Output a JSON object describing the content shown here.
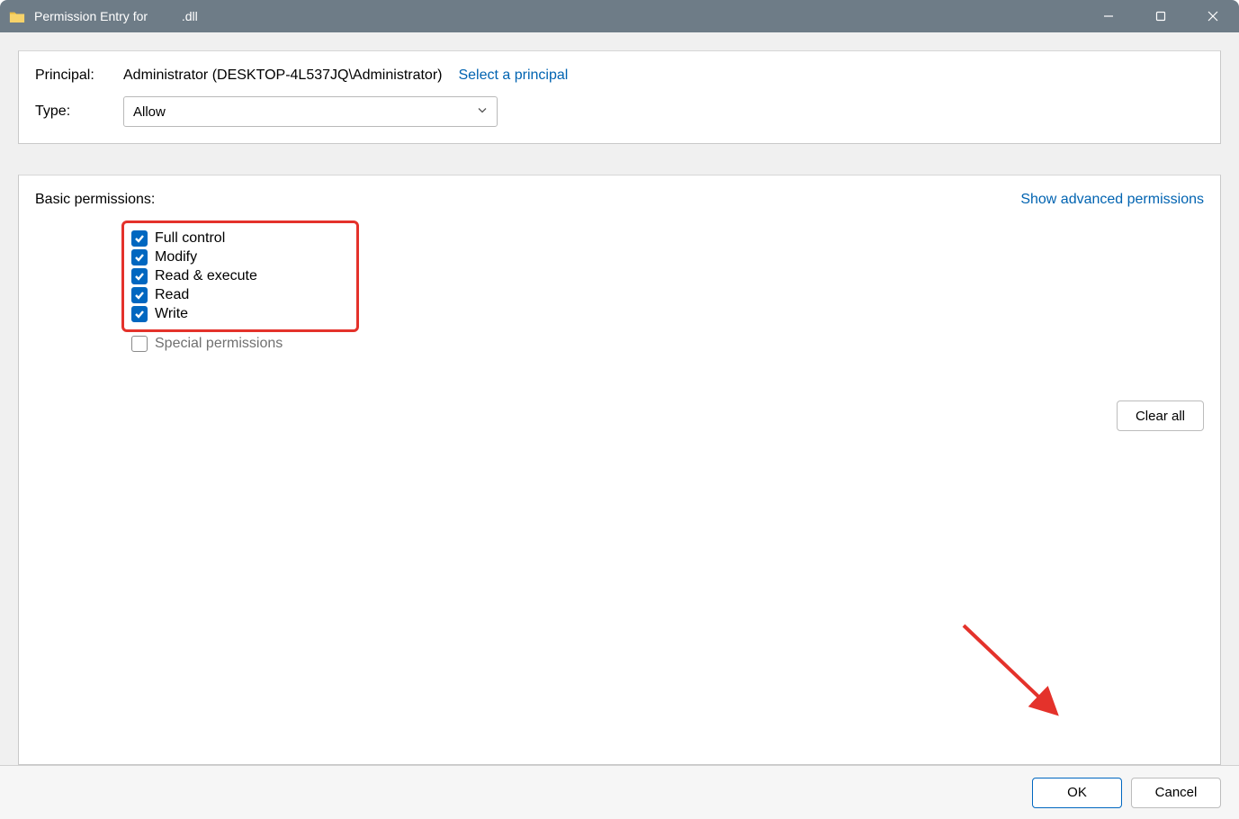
{
  "titlebar": {
    "prefix": "Permission Entry for",
    "filename_suffix": ".dll"
  },
  "top": {
    "principal_label": "Principal:",
    "principal_value": "Administrator (DESKTOP-4L537JQ\\Administrator)",
    "select_principal_link": "Select a principal",
    "type_label": "Type:",
    "type_value": "Allow"
  },
  "permissions": {
    "section_label": "Basic permissions:",
    "advanced_link": "Show advanced permissions",
    "items": {
      "full_control": {
        "label": "Full control",
        "checked": true
      },
      "modify": {
        "label": "Modify",
        "checked": true
      },
      "read_exec": {
        "label": "Read & execute",
        "checked": true
      },
      "read": {
        "label": "Read",
        "checked": true
      },
      "write": {
        "label": "Write",
        "checked": true
      },
      "special": {
        "label": "Special permissions",
        "checked": false,
        "disabled": true
      }
    },
    "clear_all": "Clear all"
  },
  "footer": {
    "ok": "OK",
    "cancel": "Cancel"
  },
  "annotation": {
    "highlight_color": "#e4322b",
    "arrow_color": "#e4322b"
  }
}
